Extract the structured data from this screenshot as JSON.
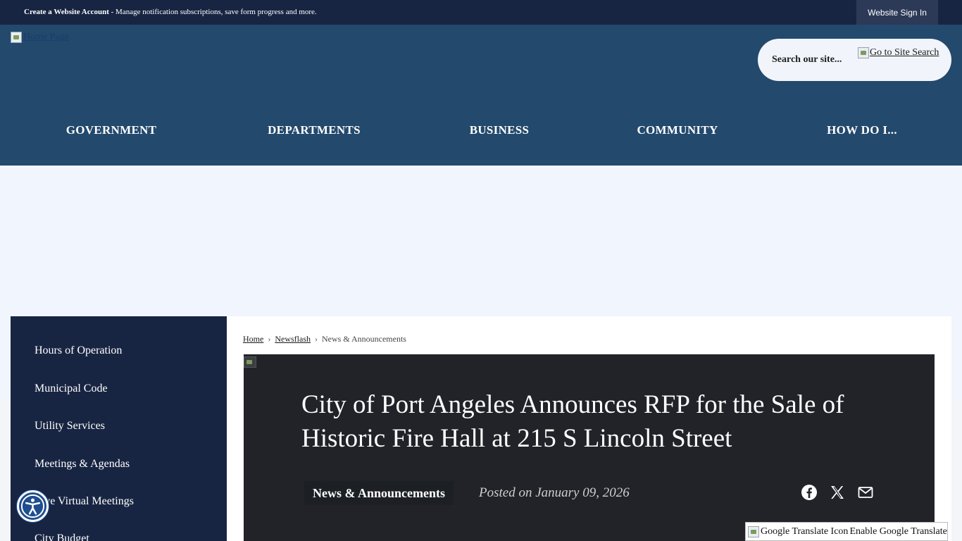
{
  "topbar": {
    "account_bold": "Create a Website Account",
    "account_rest": " - Manage notification subscriptions, save form progress and more.",
    "signin_label": "Website Sign In"
  },
  "header": {
    "logo_alt": "Home Page",
    "search_placeholder": "Search our site...",
    "search_go_alt": "Go to Site Search"
  },
  "nav": {
    "items": [
      "GOVERNMENT",
      "DEPARTMENTS",
      "BUSINESS",
      "COMMUNITY",
      "HOW DO I..."
    ]
  },
  "sidebar": {
    "items": [
      "Hours of Operation",
      "Municipal Code",
      "Utility Services",
      "Meetings & Agendas",
      "Live Virtual Meetings",
      "City Budget"
    ]
  },
  "breadcrumb": {
    "home": "Home",
    "newsflash": " Newsflash",
    "current": "News & Announcements"
  },
  "article": {
    "title": "City of Port Angeles Announces RFP for the Sale of Historic Fire Hall at 215 S Lincoln Street",
    "category": "News & Announcements",
    "posted": "Posted on January 09, 2026"
  },
  "share": {
    "icons": [
      "facebook-icon",
      "x-icon",
      "email-icon"
    ]
  },
  "translate": {
    "icon_alt": "Google Translate Icon",
    "label": "Enable Google Translate"
  },
  "colors": {
    "topbar": "#182542",
    "header": "#23496d",
    "sidebar": "#182542",
    "article_bg": "#212328",
    "banner": "#f1f5fd"
  }
}
